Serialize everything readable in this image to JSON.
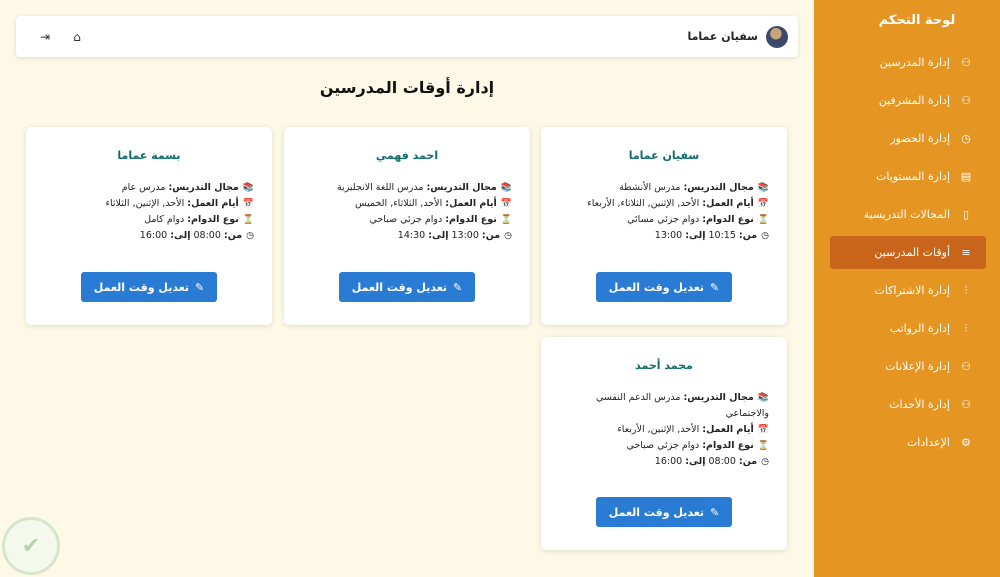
{
  "sidebar": {
    "title": "لوحة التحكم",
    "items": [
      {
        "label": "إدارة المدرسين",
        "icon": "⚇"
      },
      {
        "label": "إدارة المشرفين",
        "icon": "⚇"
      },
      {
        "label": "إدارة الحضور",
        "icon": "◷"
      },
      {
        "label": "إدارة المستويات",
        "icon": "▤"
      },
      {
        "label": "المجالات التدريسية",
        "icon": "▯"
      },
      {
        "label": "أوقات المدرسين",
        "icon": "≡"
      },
      {
        "label": "إدارة الاشتراكات",
        "icon": "⫶"
      },
      {
        "label": "إدارة الرواتب",
        "icon": "⫶"
      },
      {
        "label": "إدارة الإعلانات",
        "icon": "⚇"
      },
      {
        "label": "إدارة الأحداث",
        "icon": "⚇"
      },
      {
        "label": "الإعدادات",
        "icon": "⚙"
      }
    ]
  },
  "header": {
    "user_name": "سفيان عماما",
    "home_icon": "⌂",
    "logout_icon": "⇥"
  },
  "page": {
    "title": "إدارة أوقات المدرسين"
  },
  "labels": {
    "field": "مجال التدريس:",
    "days": "أيام العمل:",
    "type": "نوع الدوام:",
    "from": "من:",
    "to": "إلى:",
    "edit": "تعديل وقت العمل"
  },
  "teachers": [
    {
      "name": "سفيان عماما",
      "field": "مدرس الأنشطة",
      "days": "الأحد, الإثنين, الثلاثاء, الأربعاء",
      "type": "دوام جزئي مسائي",
      "from": "10:15",
      "to": "13:00"
    },
    {
      "name": "احمد فهمي",
      "field": "مدرس اللغة الانجليزية",
      "days": "الأحد, الثلاثاء, الخميس",
      "type": "دوام جزئي صباحي",
      "from": "13:00",
      "to": "14:30"
    },
    {
      "name": "بسمة عماما",
      "field": "مدرس عام",
      "days": "الأحد, الإثنين, الثلاثاء",
      "type": "دوام كامل",
      "from": "08:00",
      "to": "16:00"
    },
    {
      "name": "محمد أحمد",
      "field": "مدرس الدعم النفسي والاجتماعي",
      "days": "الأحد, الإثنين, الأربعاء",
      "type": "دوام جزئي صباحي",
      "from": "08:00",
      "to": "16:00"
    }
  ]
}
